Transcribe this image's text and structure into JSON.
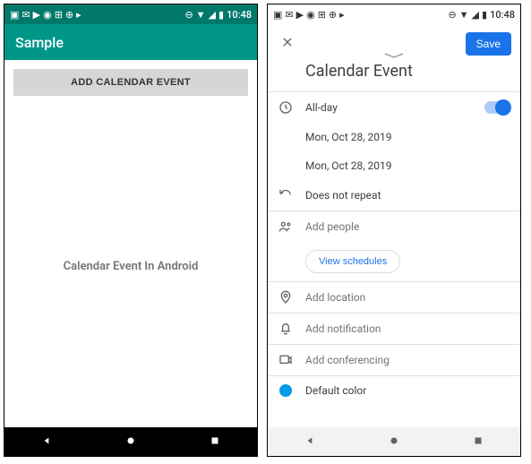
{
  "status": {
    "time": "10:48"
  },
  "left": {
    "appTitle": "Sample",
    "addButton": "ADD CALENDAR EVENT",
    "centerText": "Calendar Event In Android"
  },
  "right": {
    "save": "Save",
    "title": "Calendar Event",
    "allday": "All-day",
    "startDate": "Mon, Oct 28, 2019",
    "endDate": "Mon, Oct 28, 2019",
    "repeat": "Does not repeat",
    "addPeople": "Add people",
    "viewSchedules": "View schedules",
    "addLocation": "Add location",
    "addNotification": "Add notification",
    "addConferencing": "Add conferencing",
    "defaultColor": "Default color"
  }
}
